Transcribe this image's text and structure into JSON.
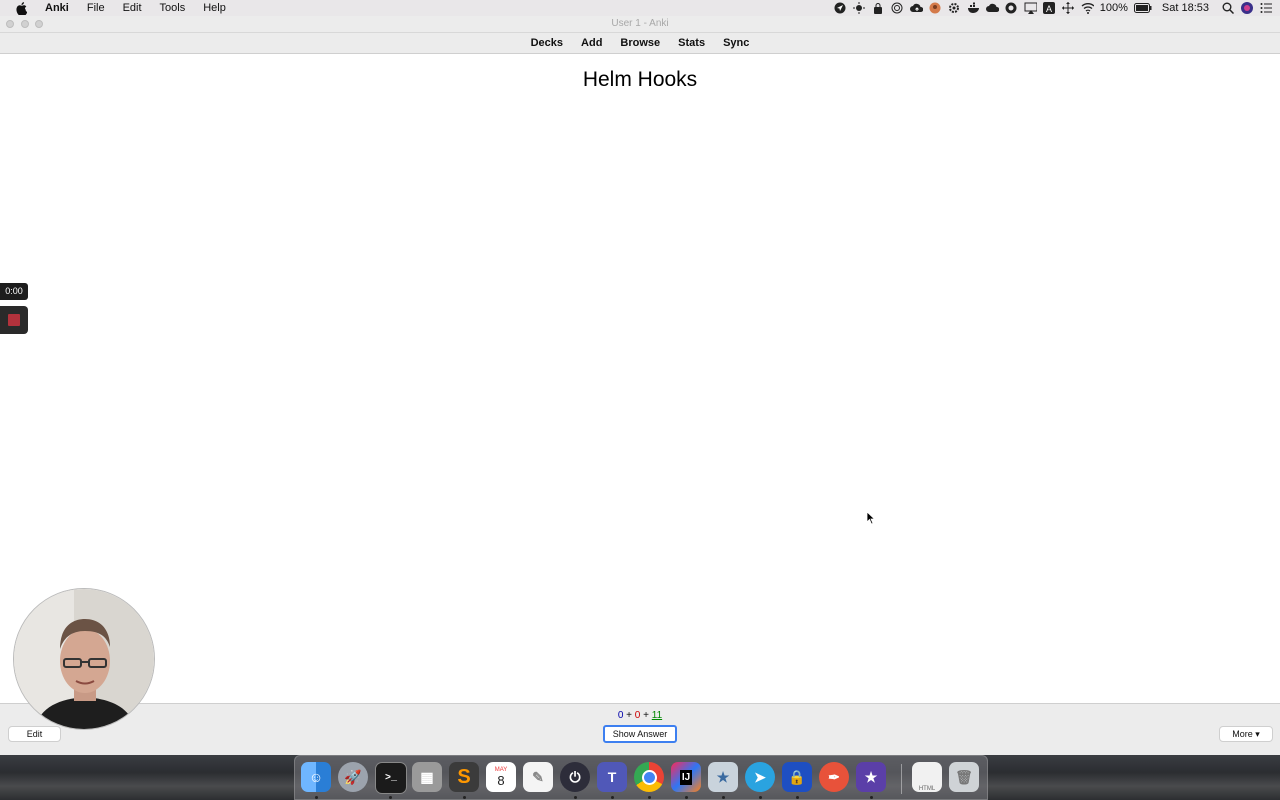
{
  "menubar": {
    "app_name": "Anki",
    "menus": [
      "File",
      "Edit",
      "Tools",
      "Help"
    ],
    "battery": "100%",
    "clock": "Sat 18:53"
  },
  "window": {
    "title": "User 1 - Anki",
    "toolbar": [
      "Decks",
      "Add",
      "Browse",
      "Stats",
      "Sync"
    ]
  },
  "card": {
    "front_text": "Helm Hooks"
  },
  "counts": {
    "new": "0",
    "learning": "0",
    "review": "11",
    "plus": "+"
  },
  "buttons": {
    "edit": "Edit",
    "show_answer": "Show Answer",
    "more": "More ▾"
  },
  "recording": {
    "timer": "0:00"
  },
  "dock": {
    "apps": [
      "finder-icon",
      "launchpad-icon",
      "terminal-icon",
      "calculator-icon",
      "sublime-text-icon",
      "calendar-icon",
      "textedit-icon",
      "power-app-icon",
      "teams-icon",
      "chrome-icon",
      "intellij-icon",
      "anki-icon",
      "telegram-icon",
      "lock-app-icon",
      "paw-icon",
      "imovie-icon",
      "html-file-icon",
      "trash-icon"
    ],
    "calendar_month": "MAY",
    "calendar_day": "8"
  }
}
